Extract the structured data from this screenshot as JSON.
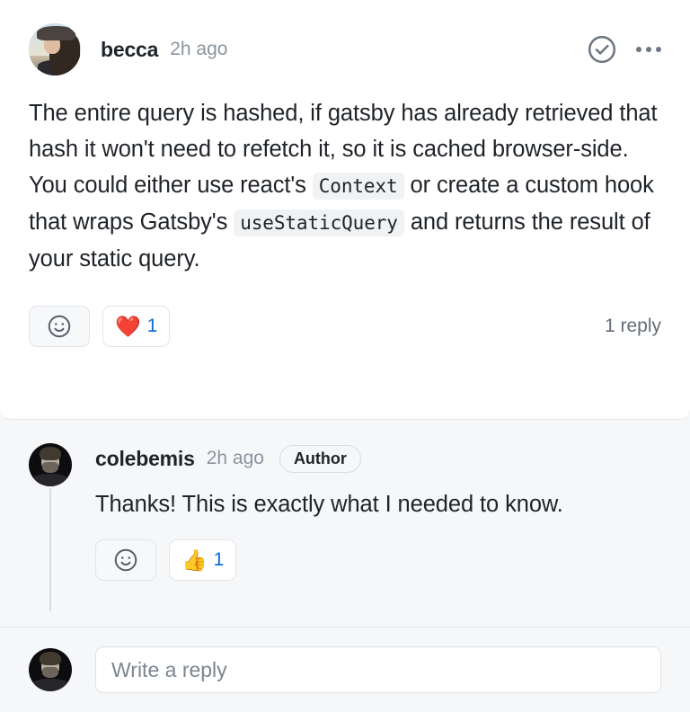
{
  "comment": {
    "author": "becca",
    "timestamp": "2h ago",
    "avatar_alt": "becca-avatar",
    "body_parts": [
      {
        "type": "text",
        "value": "The entire query is hashed, if gatsby has already retrieved that hash it won't need to refetch it, so it is cached browser-side. You could either use react's "
      },
      {
        "type": "code",
        "value": "Context"
      },
      {
        "type": "text",
        "value": " or create a custom hook that wraps Gatsby's "
      },
      {
        "type": "code",
        "value": "useStaticQuery"
      },
      {
        "type": "text",
        "value": " and returns the result of your static query."
      }
    ],
    "actions": {
      "resolve_icon": "check-circle-icon",
      "more_icon": "kebab-menu-icon"
    },
    "reactions": {
      "add_label": "add-reaction",
      "add_icon": "smiley-icon",
      "items": [
        {
          "emoji": "❤️",
          "name": "heart",
          "count": "1"
        }
      ]
    },
    "reply_count_label": "1 reply"
  },
  "reply": {
    "author": "colebemis",
    "timestamp": "2h ago",
    "badge": "Author",
    "avatar_alt": "colebemis-avatar",
    "text": "Thanks! This is exactly what I needed to know.",
    "reactions": {
      "add_icon": "smiley-icon",
      "items": [
        {
          "emoji": "👍",
          "name": "thumbs-up",
          "count": "1"
        }
      ]
    }
  },
  "composer": {
    "placeholder": "Write a reply",
    "value": "",
    "avatar_alt": "current-user-avatar"
  },
  "colors": {
    "accent": "#0969da",
    "card_bg": "#ffffff",
    "page_bg": "#f6f7f9",
    "border": "#e4e6ea",
    "text": "#1f2328",
    "muted": "#8b949e"
  }
}
